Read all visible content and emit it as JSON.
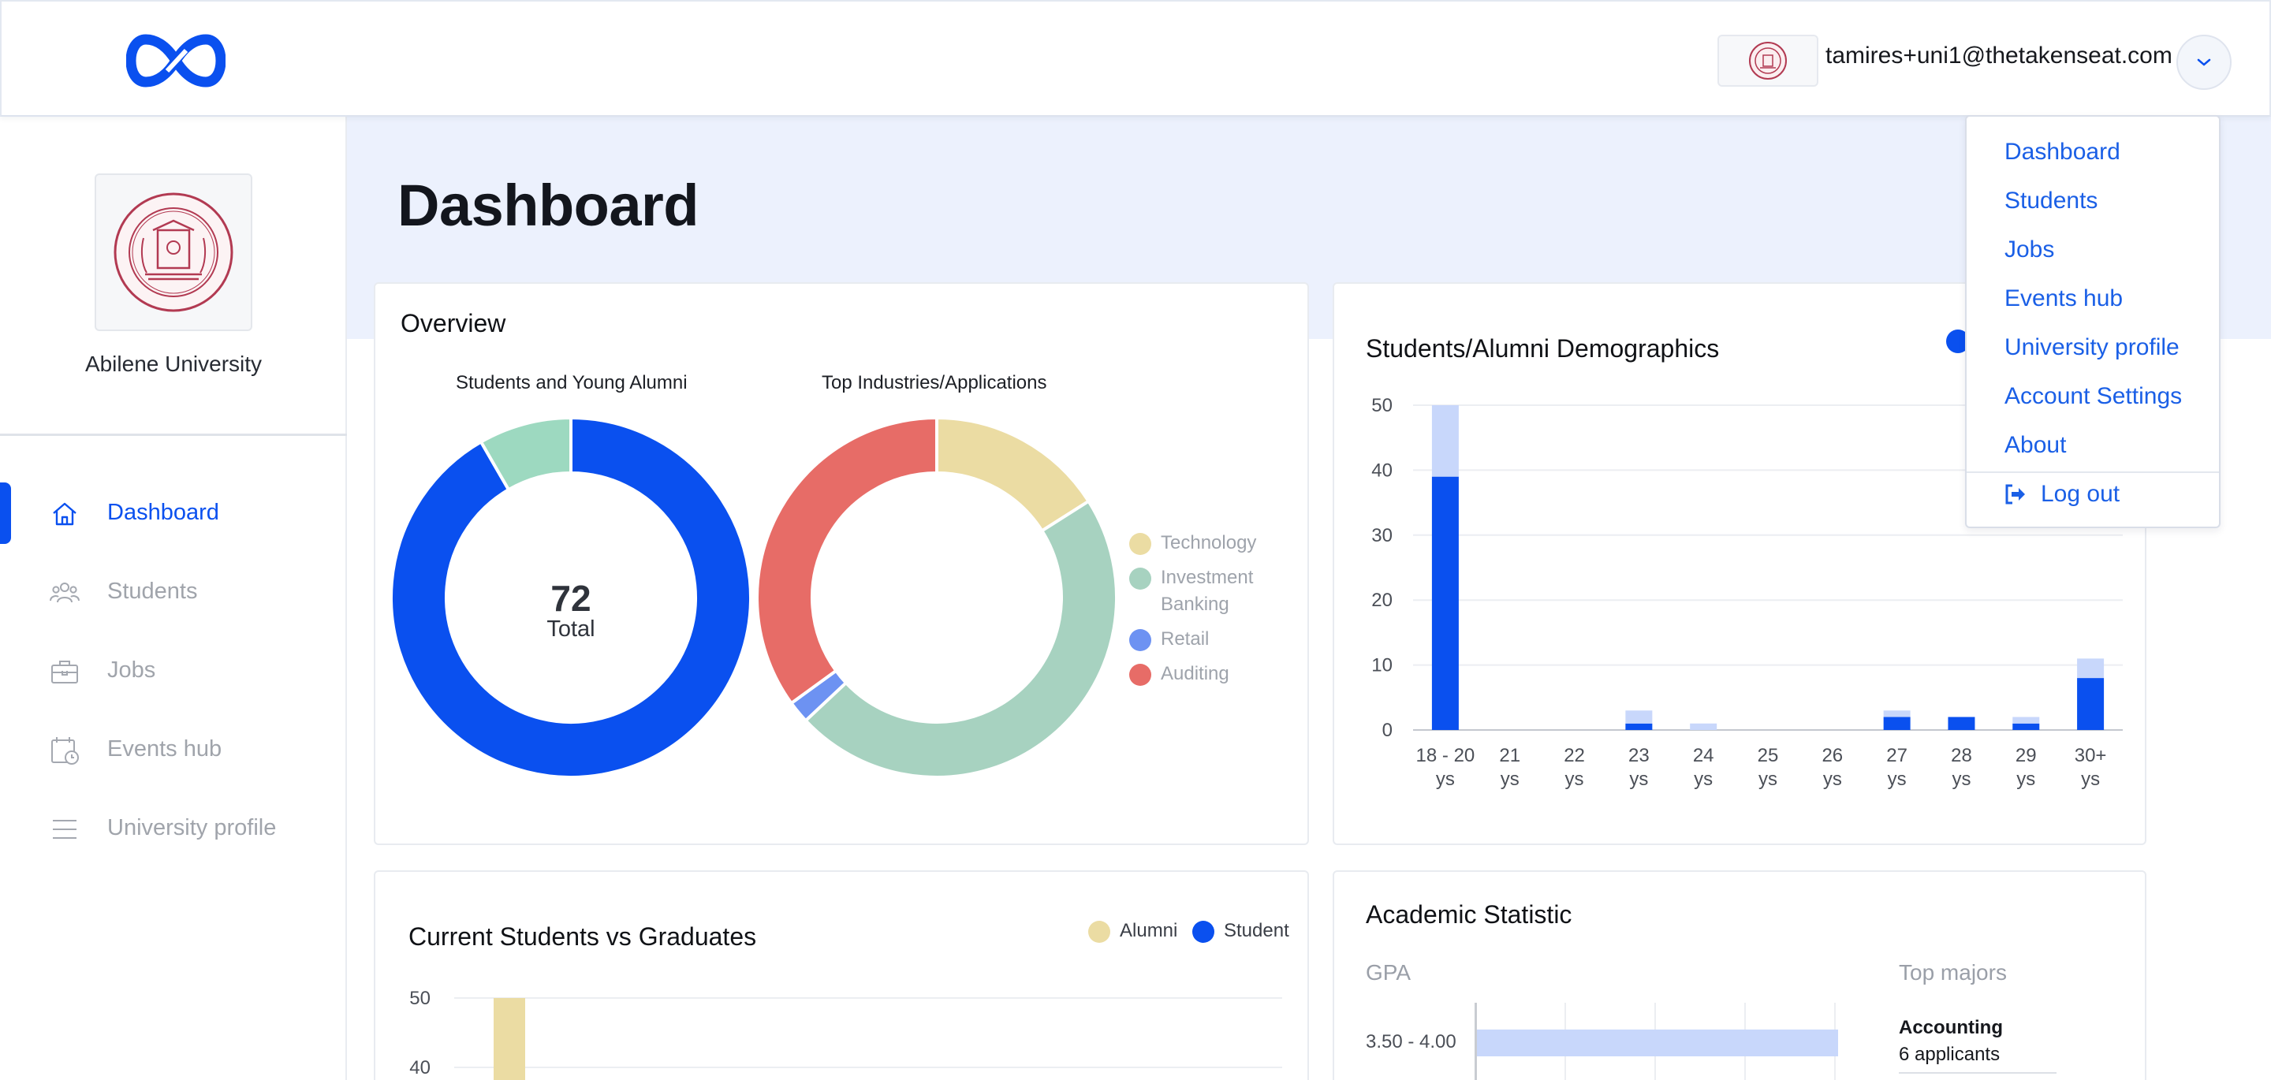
{
  "header": {
    "logo_name": "infinity-logo-icon",
    "user_email": "tamires+uni1@thetakenseat.com",
    "brand_color": "#0a50ef"
  },
  "sidebar": {
    "university_name": "Abilene University",
    "items": [
      {
        "label": "Dashboard",
        "icon": "home-icon",
        "active": true
      },
      {
        "label": "Students",
        "icon": "users-icon",
        "active": false
      },
      {
        "label": "Jobs",
        "icon": "briefcase-icon",
        "active": false
      },
      {
        "label": "Events hub",
        "icon": "calendar-clock-icon",
        "active": false
      },
      {
        "label": "University profile",
        "icon": "list-icon",
        "active": false
      }
    ]
  },
  "dropdown": {
    "items": [
      "Dashboard",
      "Students",
      "Jobs",
      "Events hub",
      "University profile",
      "Account Settings",
      "About"
    ],
    "logout_label": "Log out"
  },
  "main": {
    "page_title": "Dashboard",
    "overview": {
      "title": "Overview",
      "donut1_title": "Students and Young Alumni",
      "total_value": "72",
      "total_label": "Total",
      "donut2_title": "Top Industries/Applications",
      "legend": [
        {
          "label": "Technology",
          "color": "#ebdca3"
        },
        {
          "label": "Investment Banking",
          "color": "#a7d2c0"
        },
        {
          "label": "Retail",
          "color": "#6d92f2"
        },
        {
          "label": "Auditing",
          "color": "#e76c67"
        }
      ]
    },
    "demographics": {
      "title": "Students/Alumni Demographics"
    },
    "current_vs_grad": {
      "title": "Current Students vs Graduates",
      "legend": [
        {
          "label": "Alumni",
          "color": "#ebdca3"
        },
        {
          "label": "Student",
          "color": "#0a50ef"
        }
      ]
    },
    "academic": {
      "title": "Academic Statistic",
      "gpa_label": "GPA",
      "majors_label": "Top majors",
      "gpa_rows": [
        {
          "label": "3.50 - 4.00"
        }
      ],
      "majors": [
        {
          "name": "Accounting",
          "detail": "6 applicants"
        }
      ]
    }
  },
  "chart_data": [
    {
      "type": "pie",
      "title": "Students and Young Alumni",
      "center_value": 72,
      "center_label": "Total",
      "slices": [
        {
          "label": "Student",
          "value": 66,
          "color": "#0a50ef"
        },
        {
          "label": "Alumni",
          "value": 6,
          "color": "#9dd9c0"
        }
      ]
    },
    {
      "type": "pie",
      "title": "Top Industries/Applications",
      "slices": [
        {
          "label": "Technology",
          "value": 16,
          "color": "#ebdca3"
        },
        {
          "label": "Investment Banking",
          "value": 47,
          "color": "#a7d2c0"
        },
        {
          "label": "Retail",
          "value": 2,
          "color": "#6d92f2"
        },
        {
          "label": "Auditing",
          "value": 35,
          "color": "#e76c67"
        }
      ]
    },
    {
      "type": "bar",
      "title": "Students/Alumni Demographics",
      "stacked": true,
      "categories": [
        "18 - 20 ys",
        "21 ys",
        "22 ys",
        "23 ys",
        "24 ys",
        "25 ys",
        "26 ys",
        "27 ys",
        "28 ys",
        "29 ys",
        "30+ ys"
      ],
      "series": [
        {
          "values": [
            39,
            0,
            0,
            1,
            0,
            0,
            0,
            2,
            2,
            1,
            8
          ],
          "color": "#0a50ef"
        },
        {
          "values": [
            11,
            0,
            0,
            2,
            1,
            0,
            0,
            1,
            0,
            1,
            3
          ],
          "color": "#c8d7fb"
        }
      ],
      "ylim": [
        0,
        50
      ],
      "yticks": [
        0,
        10,
        20,
        30,
        40,
        50
      ],
      "grid": true
    },
    {
      "type": "bar",
      "title": "Current Students vs Graduates",
      "yticks": [
        40,
        50
      ],
      "series": [
        {
          "name": "Alumni",
          "color": "#ebdca3"
        },
        {
          "name": "Student",
          "color": "#0a50ef"
        }
      ],
      "grid": true
    }
  ]
}
